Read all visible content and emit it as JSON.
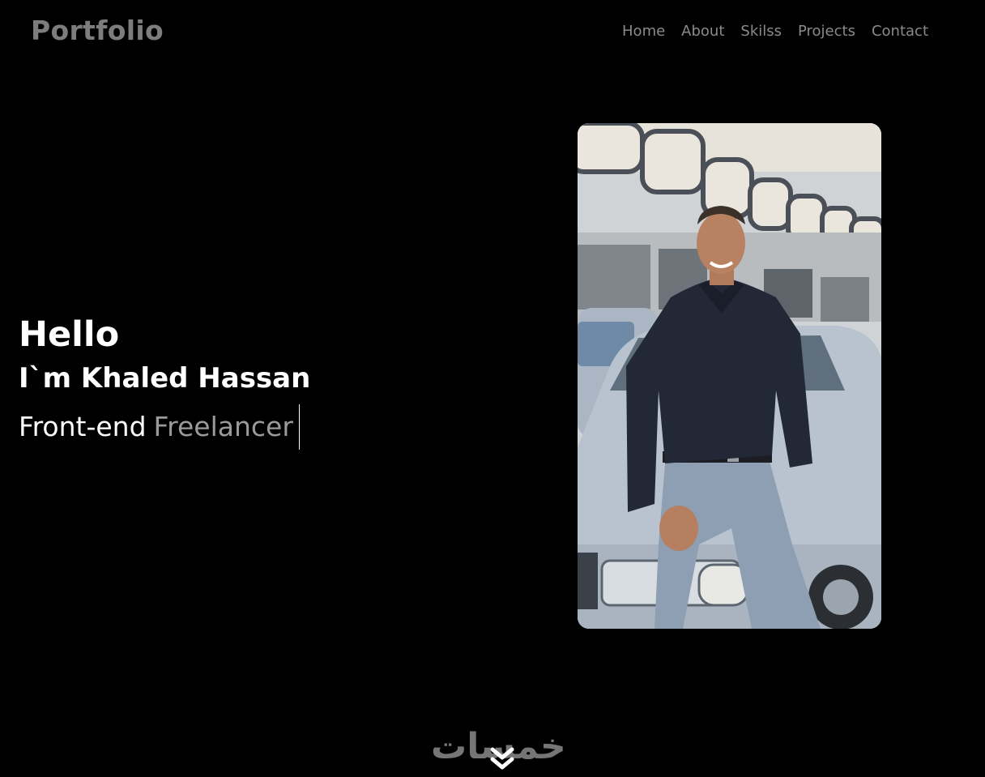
{
  "header": {
    "logo": "Portfolio",
    "nav": [
      {
        "label": "Home"
      },
      {
        "label": "About"
      },
      {
        "label": "Skilss"
      },
      {
        "label": "Projects"
      },
      {
        "label": "Contact"
      }
    ]
  },
  "hero": {
    "greeting": "Hello",
    "intro": "I`m Khaled Hassan",
    "role_static": "Front-end",
    "role_typed": "Freelancer"
  },
  "watermark": "خمسات",
  "icons": {
    "scroll": "chevron-double-down-icon"
  },
  "colors": {
    "background": "#000000",
    "text": "#ffffff",
    "muted": "#8a8a8a"
  }
}
